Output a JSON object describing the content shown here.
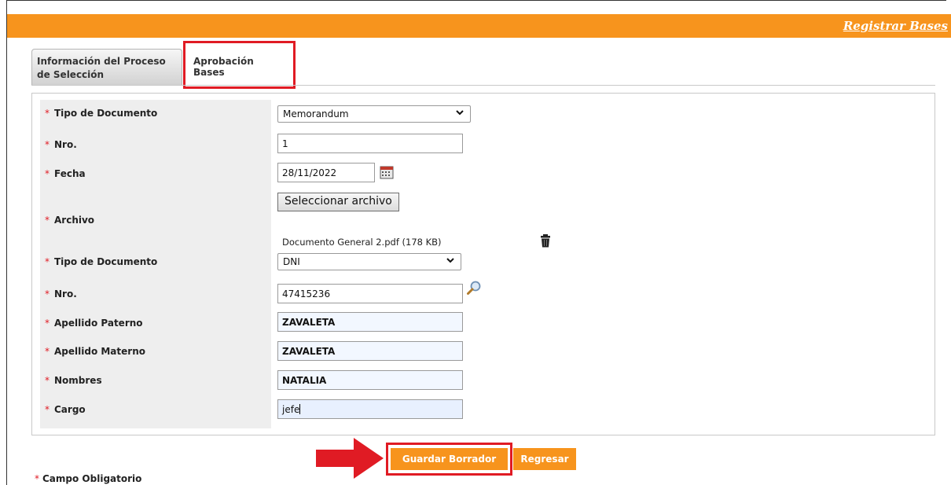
{
  "header": {
    "link_label": "Registrar Bases"
  },
  "tabs": [
    {
      "label": "Información del Proceso de Selección"
    },
    {
      "label": "Aprobación Bases"
    }
  ],
  "form": {
    "required_mark": "*",
    "tipo_documento_1": {
      "label": "Tipo de Documento",
      "value": "Memorandum"
    },
    "nro_1": {
      "label": "Nro.",
      "value": "1"
    },
    "fecha": {
      "label": "Fecha",
      "value": "28/11/2022"
    },
    "archivo": {
      "label": "Archivo",
      "button_label": "Seleccionar archivo",
      "file_name": "Documento General 2.pdf (178 KB)"
    },
    "tipo_documento_2": {
      "label": "Tipo de Documento",
      "value": "DNI"
    },
    "nro_2": {
      "label": "Nro.",
      "value": "47415236"
    },
    "apellido_paterno": {
      "label": "Apellido Paterno",
      "value": "ZAVALETA"
    },
    "apellido_materno": {
      "label": "Apellido Materno",
      "value": "ZAVALETA"
    },
    "nombres": {
      "label": "Nombres",
      "value": "NATALIA"
    },
    "cargo": {
      "label": "Cargo",
      "value": "jefe"
    }
  },
  "actions": {
    "save_label": "Guardar Borrador",
    "back_label": "Regresar"
  },
  "footnote": "Campo Obligatorio",
  "colors": {
    "accent": "#f7941d",
    "highlight": "#e01b24"
  }
}
